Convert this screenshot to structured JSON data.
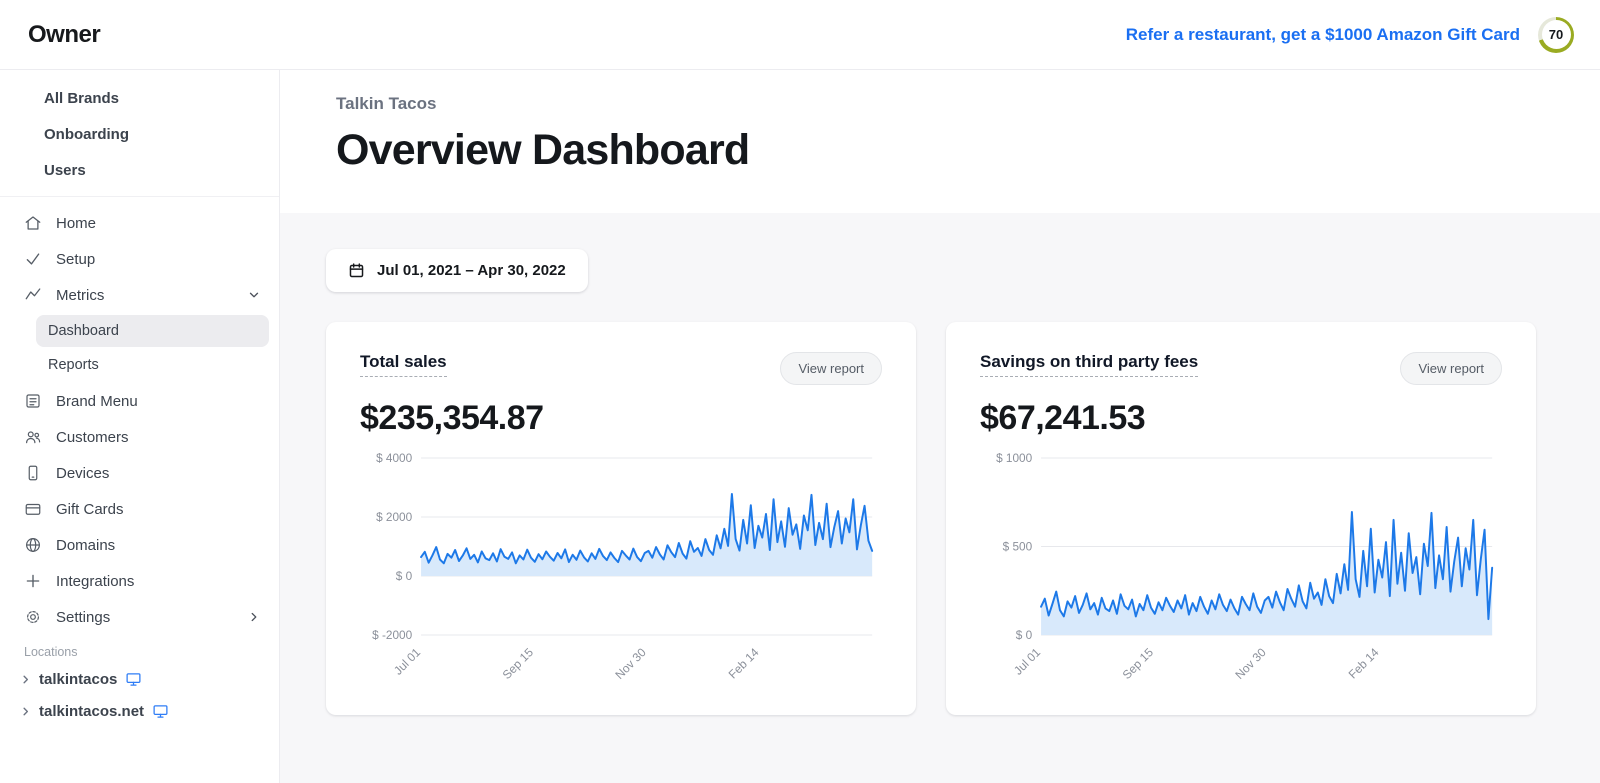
{
  "header": {
    "logo": "Owner",
    "referral_link": "Refer a restaurant, get a $1000 Amazon Gift Card",
    "score_badge": "70"
  },
  "sidebar": {
    "top_items": [
      {
        "label": "All Brands"
      },
      {
        "label": "Onboarding"
      },
      {
        "label": "Users"
      }
    ],
    "menu": [
      {
        "label": "Home",
        "icon": "home-icon"
      },
      {
        "label": "Setup",
        "icon": "check-icon"
      },
      {
        "label": "Metrics",
        "icon": "metrics-icon",
        "expanded": true,
        "children": [
          {
            "label": "Dashboard",
            "active": true
          },
          {
            "label": "Reports",
            "active": false
          }
        ]
      },
      {
        "label": "Brand Menu",
        "icon": "brand-menu-icon"
      },
      {
        "label": "Customers",
        "icon": "customers-icon"
      },
      {
        "label": "Devices",
        "icon": "device-icon"
      },
      {
        "label": "Gift Cards",
        "icon": "gift-card-icon"
      },
      {
        "label": "Domains",
        "icon": "globe-icon"
      },
      {
        "label": "Integrations",
        "icon": "plus-icon"
      },
      {
        "label": "Settings",
        "icon": "gear-icon",
        "has_submenu": true
      }
    ],
    "locations_label": "Locations",
    "locations": [
      {
        "label": "talkintacos"
      },
      {
        "label": "talkintacos.net"
      }
    ]
  },
  "page": {
    "brand": "Talkin Tacos",
    "title": "Overview Dashboard",
    "date_range": "Jul 01, 2021 – Apr 30, 2022"
  },
  "cards": [
    {
      "title": "Total sales",
      "amount": "$235,354.87",
      "action": "View report"
    },
    {
      "title": "Savings on third party fees",
      "amount": "$67,241.53",
      "action": "View report"
    }
  ],
  "colors": {
    "accent": "#1a6ff2",
    "chart_line": "#1d79e8",
    "chart_fill": "#d8e9fb",
    "grid": "#e7e8ec",
    "tick_text": "#8b909a"
  },
  "chart_data": [
    {
      "type": "line",
      "title": "Total sales",
      "x_range": [
        "Jul 01, 2021",
        "Apr 30, 2022"
      ],
      "ylabel": "$",
      "ylim": [
        -2000,
        4000
      ],
      "yticks": [
        4000,
        2000,
        0,
        -2000
      ],
      "xticks": [
        {
          "label": "Jul 01",
          "pos": 0
        },
        {
          "label": "Sep 15",
          "pos": 0.25
        },
        {
          "label": "Nov 30",
          "pos": 0.5
        },
        {
          "label": "Feb 14",
          "pos": 0.75
        }
      ],
      "values": [
        640,
        820,
        450,
        700,
        980,
        560,
        430,
        750,
        620,
        880,
        510,
        690,
        940,
        580,
        720,
        460,
        830,
        600,
        540,
        770,
        490,
        910,
        650,
        580,
        800,
        430,
        700,
        560,
        890,
        620,
        480,
        740,
        570,
        830,
        650,
        520,
        780,
        600,
        900,
        470,
        720,
        550,
        860,
        630,
        490,
        770,
        580,
        920,
        680,
        540,
        800,
        610,
        470,
        850,
        700,
        560,
        930,
        640,
        500,
        780,
        850,
        620,
        980,
        730,
        560,
        1040,
        810,
        640,
        1120,
        760,
        590,
        1180,
        820,
        950,
        680,
        1250,
        880,
        720,
        1380,
        940,
        1600,
        1020,
        2780,
        1250,
        860,
        1900,
        1100,
        2400,
        950,
        1700,
        1300,
        2100,
        880,
        2600,
        1150,
        1850,
        990,
        2300,
        1400,
        1750,
        920,
        2050,
        1550,
        2750,
        1050,
        1800,
        1250,
        2450,
        980,
        1650,
        2200,
        1100,
        1950,
        1480,
        2600,
        900,
        1720,
        2380,
        1200,
        850
      ]
    },
    {
      "type": "line",
      "title": "Savings on third party fees",
      "x_range": [
        "Jul 01, 2021",
        "Apr 30, 2022"
      ],
      "ylabel": "$",
      "ylim": [
        0,
        1000
      ],
      "yticks": [
        1000,
        500,
        0
      ],
      "xticks": [
        {
          "label": "Jul 01",
          "pos": 0
        },
        {
          "label": "Sep 15",
          "pos": 0.25
        },
        {
          "label": "Nov 30",
          "pos": 0.5
        },
        {
          "label": "Feb 14",
          "pos": 0.75
        }
      ],
      "values": [
        160,
        205,
        110,
        175,
        245,
        140,
        105,
        190,
        155,
        220,
        125,
        170,
        235,
        145,
        180,
        115,
        210,
        150,
        135,
        195,
        120,
        230,
        165,
        145,
        200,
        105,
        175,
        140,
        225,
        155,
        120,
        185,
        140,
        210,
        165,
        130,
        195,
        150,
        225,
        115,
        180,
        135,
        215,
        160,
        120,
        195,
        145,
        230,
        170,
        135,
        200,
        150,
        115,
        215,
        175,
        140,
        235,
        160,
        125,
        195,
        215,
        155,
        245,
        185,
        140,
        260,
        205,
        160,
        280,
        190,
        150,
        295,
        205,
        240,
        170,
        315,
        220,
        180,
        345,
        235,
        400,
        255,
        695,
        315,
        215,
        475,
        275,
        600,
        240,
        425,
        325,
        525,
        220,
        650,
        290,
        465,
        250,
        575,
        350,
        440,
        230,
        515,
        390,
        690,
        265,
        450,
        315,
        610,
        245,
        415,
        550,
        275,
        490,
        370,
        650,
        225,
        430,
        595,
        90,
        380
      ]
    }
  ]
}
